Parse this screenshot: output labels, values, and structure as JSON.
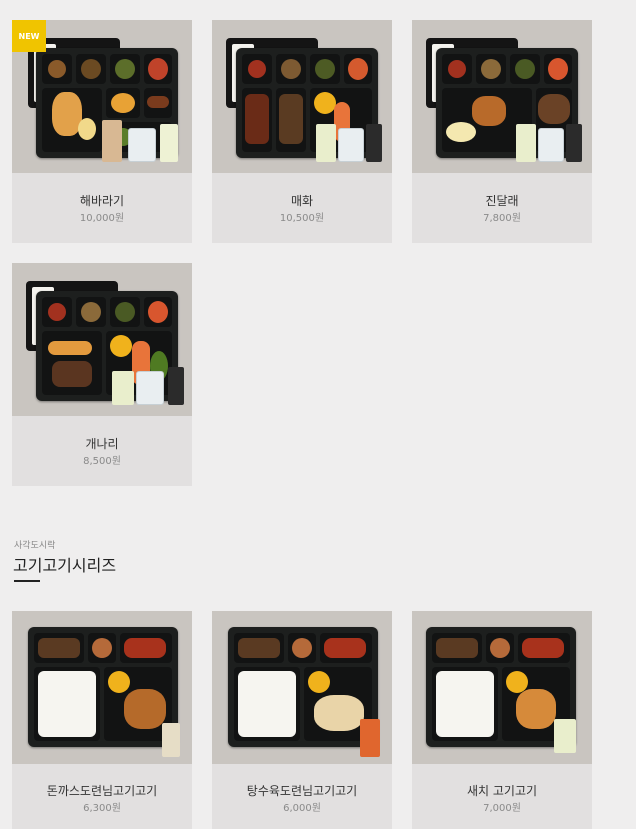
{
  "top_products": [
    {
      "name": "해바라기",
      "price": "10,000원",
      "badge": "NEW",
      "image_alt": "해바라기 도시락"
    },
    {
      "name": "매화",
      "price": "10,500원",
      "image_alt": "매화 도시락"
    },
    {
      "name": "진달래",
      "price": "7,800원",
      "image_alt": "진달래 도시락"
    },
    {
      "name": "개나리",
      "price": "8,500원",
      "image_alt": "개나리 도시락"
    }
  ],
  "section": {
    "subtitle": "사각도시락",
    "title": "고기고기시리즈"
  },
  "series_products": [
    {
      "name": "돈까스도련님고기고기",
      "price": "6,300원",
      "image_alt": "돈까스도련님고기고기 도시락"
    },
    {
      "name": "탕수육도련님고기고기",
      "price": "6,000원",
      "image_alt": "탕수육도련님고기고기 도시락"
    },
    {
      "name": "새치 고기고기",
      "price": "7,000원",
      "image_alt": "새치 고기고기 도시락"
    }
  ],
  "colors": {
    "page_bg": "#efeeee",
    "image_bg": "#c9c5c0",
    "caption_bg": "#e2e0e0",
    "badge": "#f0c400"
  }
}
